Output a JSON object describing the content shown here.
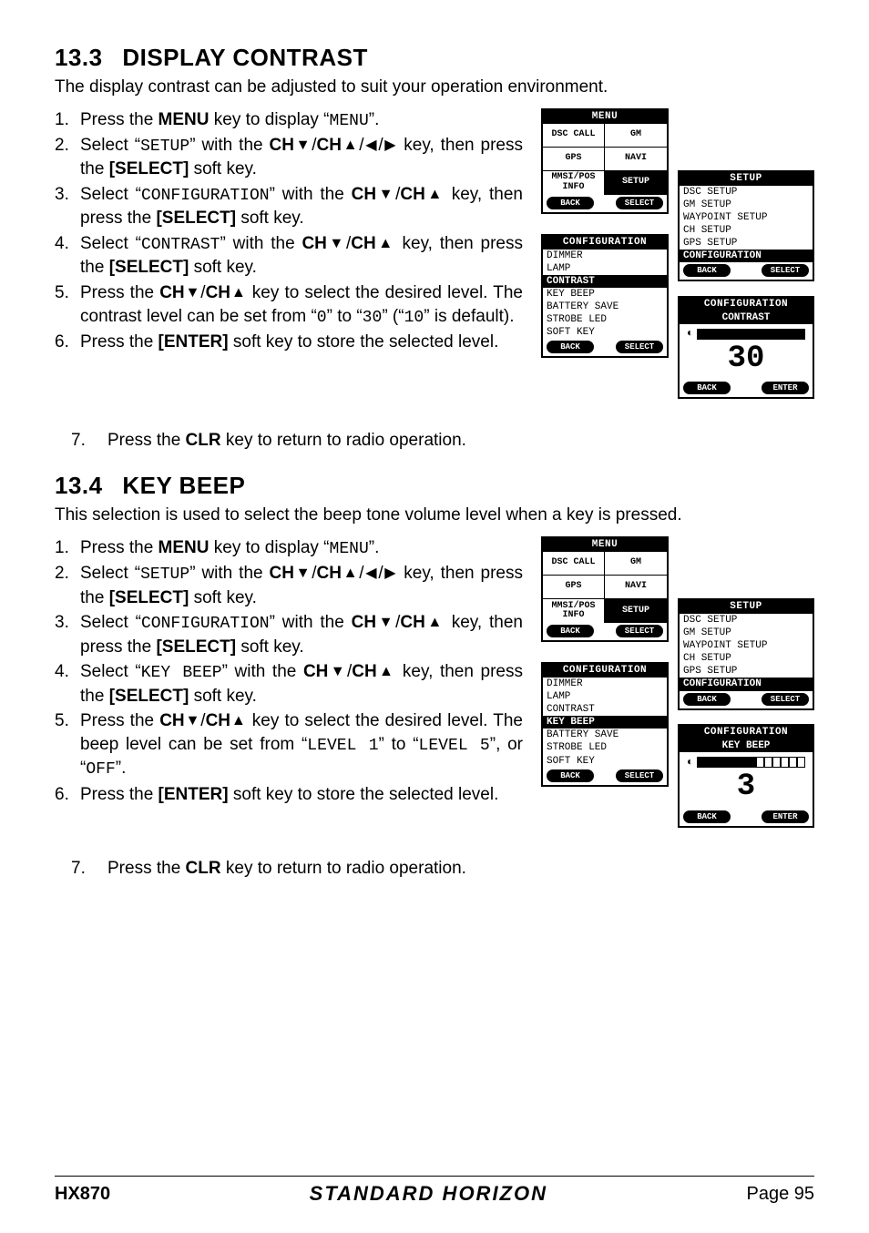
{
  "section1": {
    "heading_num": "13.3",
    "heading_text": "DISPLAY CONTRAST",
    "intro": "The display contrast can be adjusted to suit your operation environment.",
    "steps": [
      {
        "n": "1.",
        "pre": "Press the ",
        "key": "MENU",
        "post": " key to display “",
        "m": "MENU",
        "tail": "”."
      },
      {
        "n": "2.",
        "raw": "Select “<span class='mono'>SETUP</span>” with the <span class='b'>CH</span><span class='tri'>▼</span>/<span class='b'>CH</span><span class='tri'>▲</span>/<span class='tri'>◀</span>/<span class='tri'>▶</span> key, then press the <span class='b'>[SELECT]</span> soft key."
      },
      {
        "n": "3.",
        "raw": "Select “<span class='mono'>CONFIGURATION</span>” with the <span class='b'>CH</span><span class='tri'>▼</span>/<span class='b'>CH</span><span class='tri'>▲</span> key, then press the <span class='b'>[SELECT]</span> soft key."
      },
      {
        "n": "4.",
        "raw": "Select “<span class='mono'>CONTRAST</span>” with the <span class='b'>CH</span><span class='tri'>▼</span>/<span class='b'>CH</span><span class='tri'>▲</span> key, then press the <span class='b'>[SELECT]</span> soft key."
      },
      {
        "n": "5.",
        "raw": "Press the <span class='b'>CH</span><span class='tri'>▼</span>/<span class='b'>CH</span><span class='tri'>▲</span> key to select the desired level. The contrast level can be set from “<span class='mono'>0</span>” to “<span class='mono'>30</span>” (“<span class='mono'>10</span>” is default)."
      },
      {
        "n": "6.",
        "raw": "Press the <span class='b'>[ENTER]</span> soft key to store the selected level."
      }
    ],
    "after": {
      "n": "7.",
      "text": "Press the <span class='b'>CLR</span> key to return to radio operation."
    }
  },
  "section2": {
    "heading_num": "13.4",
    "heading_text": "KEY BEEP",
    "intro": "This selection is used to select the beep tone volume level when a key is pressed.",
    "steps": [
      {
        "n": "1.",
        "pre": "Press the ",
        "key": "MENU",
        "post": " key to display “",
        "m": "MENU",
        "tail": "”."
      },
      {
        "n": "2.",
        "raw": "Select “<span class='mono'>SETUP</span>” with the <span class='b'>CH</span><span class='tri'>▼</span>/<span class='b'>CH</span><span class='tri'>▲</span>/<span class='tri'>◀</span>/<span class='tri'>▶</span> key, then press the <span class='b'>[SELECT]</span> soft key."
      },
      {
        "n": "3.",
        "raw": "Select “<span class='mono'>CONFIGURATION</span>” with the <span class='b'>CH</span><span class='tri'>▼</span>/<span class='b'>CH</span><span class='tri'>▲</span> key, then press the <span class='b'>[SELECT]</span> soft key."
      },
      {
        "n": "4.",
        "raw": "Select “<span class='mono'>KEY BEEP</span>” with the <span class='b'>CH</span><span class='tri'>▼</span>/<span class='b'>CH</span><span class='tri'>▲</span> key, then press the <span class='b'>[SELECT]</span> soft key."
      },
      {
        "n": "5.",
        "raw": "Press the <span class='b'>CH</span><span class='tri'>▼</span>/<span class='b'>CH</span><span class='tri'>▲</span> key to select the desired level. The beep level can be set from “<span class='mono'>LEVEL 1</span>” to “<span class='mono'>LEVEL 5</span>”, or “<span class='mono'>OFF</span>”."
      },
      {
        "n": "6.",
        "raw": "Press the <span class='b'>[ENTER]</span> soft key to store the selected level."
      }
    ],
    "after": {
      "n": "7.",
      "text": "Press the <span class='b'>CLR</span> key to return to radio operation."
    }
  },
  "lcd": {
    "menu_title": "MENU",
    "menu_cells": [
      "DSC CALL",
      "GM",
      "GPS",
      "NAVI",
      "MMSI/POS INFO",
      "SETUP"
    ],
    "menu_back": "BACK",
    "menu_select": "SELECT",
    "setup_title": "SETUP",
    "setup_items": [
      "DSC SETUP",
      "GM SETUP",
      "WAYPOINT SETUP",
      "CH SETUP",
      "GPS SETUP",
      "CONFIGURATION"
    ],
    "conf_title": "CONFIGURATION",
    "conf_items": [
      "DIMMER",
      "LAMP",
      "CONTRAST",
      "KEY BEEP",
      "BATTERY SAVE",
      "STROBE LED",
      "SOFT KEY"
    ],
    "back": "BACK",
    "select": "SELECT",
    "enter": "ENTER",
    "s1": {
      "sub": "CONTRAST",
      "value": "30",
      "conf_hi": "CONTRAST",
      "fill": "100%"
    },
    "s2": {
      "sub": "KEY BEEP",
      "value": "3",
      "conf_hi": "KEY BEEP",
      "fill": "55%"
    }
  },
  "footer": {
    "model": "HX870",
    "brand": "STANDARD HORIZON",
    "page": "Page 95"
  }
}
